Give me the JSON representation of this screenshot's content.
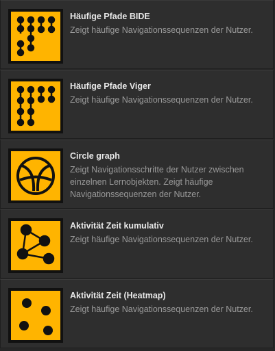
{
  "colors": {
    "background": "#272727",
    "item_background": "#2e2e2e",
    "icon_fill": "#ffb400",
    "icon_ink": "#111111",
    "title_text": "#e8e8e8",
    "description_text": "#9a9a9a"
  },
  "items": [
    {
      "icon": "sequence-dots-icon",
      "title": "Häufige Pfade BIDE",
      "description": "Zeigt häufige Navigationssequenzen der Nutzer."
    },
    {
      "icon": "sequence-dots-icon",
      "title": "Häufige Pfade Viger",
      "description": "Zeigt häufige Navigationssequenzen der Nutzer."
    },
    {
      "icon": "circle-graph-icon",
      "title": "Circle graph",
      "description": "Zeigt Navigationsschritte der Nutzer zwischen einzelnen Lernobjekten. Zeigt häufige Navigationssequenzen der Nutzer."
    },
    {
      "icon": "network-graph-icon",
      "title": "Aktivität Zeit kumulativ",
      "description": "Zeigt häufige Navigationssequenzen der Nutzer."
    },
    {
      "icon": "scatter-dots-icon",
      "title": "Aktivität Zeit (Heatmap)",
      "description": "Zeigt häufige Navigationssequenzen der Nutzer."
    }
  ]
}
